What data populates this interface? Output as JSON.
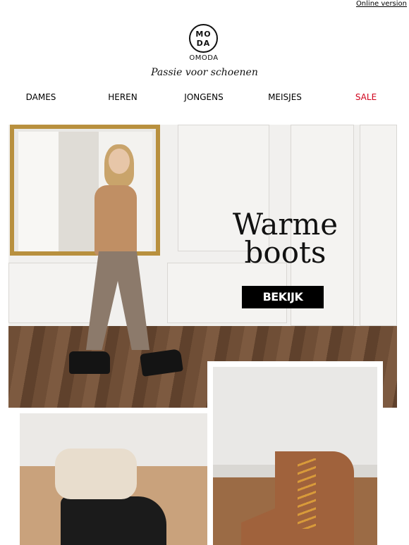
{
  "header": {
    "online_version": "Online version",
    "logo": {
      "line1": "MO",
      "line2": "DA",
      "wordmark": "OMODA"
    },
    "tagline": "Passie voor schoenen"
  },
  "nav": {
    "items": [
      {
        "label": "DAMES"
      },
      {
        "label": "HEREN"
      },
      {
        "label": "JONGENS"
      },
      {
        "label": "MEISJES"
      },
      {
        "label": "SALE",
        "color": "#d0021b"
      }
    ]
  },
  "hero": {
    "title_line1": "Warme",
    "title_line2": "boots",
    "cta": "BEKIJK"
  },
  "colors": {
    "sale": "#d0021b",
    "cta_bg": "#000000",
    "cta_text": "#ffffff"
  }
}
